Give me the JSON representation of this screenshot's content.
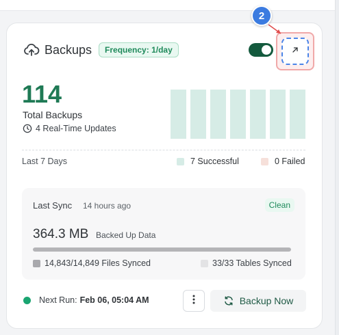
{
  "card": {
    "title": "Backups",
    "frequency_badge": "Frequency: 1/day",
    "toggle_on": true,
    "step_marker": "2",
    "total_count": "114",
    "total_label": "Total Backups",
    "realtime_updates": "4 Real-Time Updates",
    "period_label": "Last 7 Days",
    "successful_label": "7 Successful",
    "failed_label": "0 Failed",
    "bar_levels": [
      1,
      1,
      1,
      1,
      1,
      1,
      1
    ]
  },
  "sync": {
    "title": "Last Sync",
    "ago": "14 hours ago",
    "status": "Clean",
    "size": "364.3 MB",
    "size_label": "Backed Up Data",
    "progress_fraction": 0.9996,
    "files": "14,843/14,849 Files Synced",
    "tables": "33/33 Tables Synced"
  },
  "footer": {
    "next_run_label": "Next Run:",
    "next_run_value": "Feb 06, 05:04 AM",
    "backup_now_label": "Backup Now"
  },
  "colors": {
    "accent": "#1f7a55",
    "toggle": "#145a3e",
    "success_swatch": "#d6ece6",
    "failed_swatch": "#f6e0da",
    "highlight": "#4a84e8"
  },
  "icons": [
    "cloud-upload-icon",
    "clock-icon",
    "expand-arrow-icon",
    "more-vertical-icon",
    "refresh-icon"
  ]
}
